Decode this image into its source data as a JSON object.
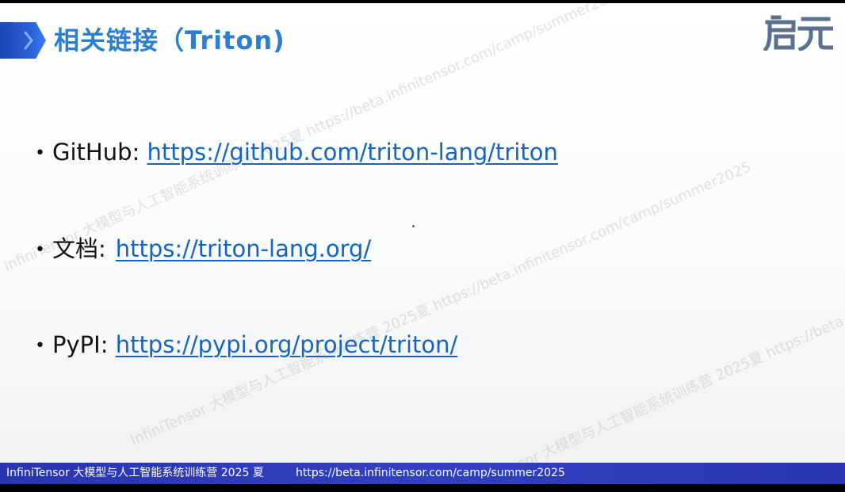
{
  "slide": {
    "title": "相关链接（Triton)",
    "logo_text": "启元"
  },
  "links": [
    {
      "label": "GitHub: ",
      "url": "https://github.com/triton-lang/triton"
    },
    {
      "label": "文档:",
      "url": "https://triton-lang.org/"
    },
    {
      "label": "PyPI: ",
      "url": "https://pypi.org/project/triton/"
    }
  ],
  "watermark": {
    "text": "InfiniTensor 大模型与人工智能系统训练营 2025夏 https://beta.infinitensor.com/camp/summer2025"
  },
  "footer": {
    "camp_name": "InfiniTensor 大模型与人工智能系统训练营 2025 夏",
    "url": "https://beta.infinitensor.com/camp/summer2025"
  },
  "colors": {
    "title": "#2b7fd0",
    "link": "#1565c0",
    "footer_bg": "#2f3bb8",
    "accent": "#1d44b8"
  }
}
